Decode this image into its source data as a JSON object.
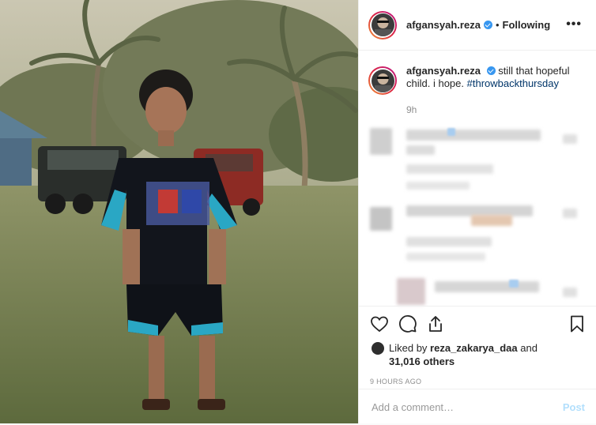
{
  "post": {
    "username": "afgansyah.reza",
    "follow_label": "Following",
    "separator": "•",
    "more_label": "•••",
    "caption": "still that hopeful child. i hope.",
    "hashtag": "#throwbackthursday",
    "time_ago": "9h",
    "liked_by_prefix": "Liked by",
    "liked_by_user": "reza_zakarya_daa",
    "liked_by_and": "and",
    "likes_count": "31,016 others",
    "timestamp": "9 HOURS AGO",
    "comment_placeholder": "Add a comment…",
    "post_label": "Post"
  },
  "colors": {
    "verified": "#3897f0",
    "hashtag": "#003569",
    "post_disabled": "#b2dffc",
    "story_ring_start": "#f09433",
    "story_ring_end": "#bc1888"
  },
  "icons": [
    "verified-badge-icon",
    "heart-icon",
    "comment-icon",
    "share-icon",
    "bookmark-icon",
    "more-options-icon"
  ]
}
